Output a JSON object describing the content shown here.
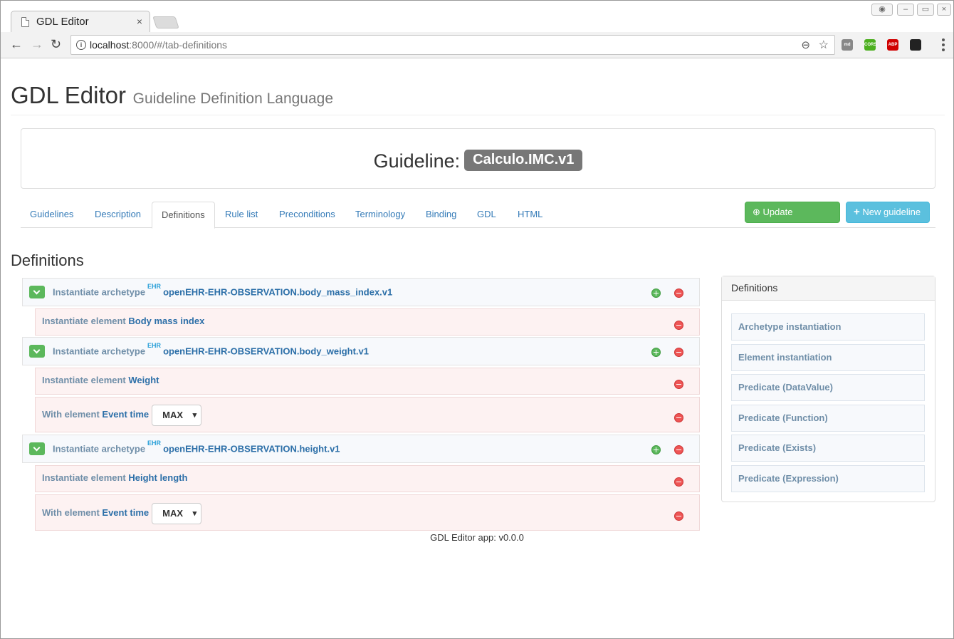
{
  "browser": {
    "tab_title": "GDL Editor",
    "tab_close": "×",
    "url_host": "localhost",
    "url_rest": ":8000/#/tab-definitions",
    "extensions": [
      {
        "name": "md-extension",
        "label": "md",
        "color": "#888888"
      },
      {
        "name": "cors-extension",
        "label": "CORS",
        "color": "#4caf1f"
      },
      {
        "name": "abp-extension",
        "label": "ABP",
        "color": "#d00000"
      },
      {
        "name": "gnome-extension",
        "label": "",
        "color": "#222222"
      }
    ]
  },
  "header": {
    "title": "GDL Editor",
    "subtitle": "Guideline Definition Language"
  },
  "guideline": {
    "prefix": "Guideline:",
    "id": "Calculo.IMC.v1"
  },
  "tabs": [
    {
      "label": "Guidelines",
      "active": false
    },
    {
      "label": "Description",
      "active": false
    },
    {
      "label": "Definitions",
      "active": true
    },
    {
      "label": "Rule list",
      "active": false
    },
    {
      "label": "Preconditions",
      "active": false
    },
    {
      "label": "Terminology",
      "active": false
    },
    {
      "label": "Binding",
      "active": false
    },
    {
      "label": "GDL",
      "active": false
    },
    {
      "label": "HTML",
      "active": false
    }
  ],
  "buttons": {
    "update": "Update guideline",
    "new": "New guideline"
  },
  "section_title": "Definitions",
  "definitions": [
    {
      "type": "archetype",
      "prefix": "Instantiate archetype",
      "tag": "EHR",
      "value": "openEHR-EHR-OBSERVATION.body_mass_index.v1"
    },
    {
      "type": "element",
      "prefix": "Instantiate element",
      "value": "Body mass index"
    },
    {
      "type": "archetype",
      "prefix": "Instantiate archetype",
      "tag": "EHR",
      "value": "openEHR-EHR-OBSERVATION.body_weight.v1"
    },
    {
      "type": "element",
      "prefix": "Instantiate element",
      "value": "Weight"
    },
    {
      "type": "with",
      "prefix": "With element",
      "value": "Event time",
      "select": "MAX"
    },
    {
      "type": "archetype",
      "prefix": "Instantiate archetype",
      "tag": "EHR",
      "value": "openEHR-EHR-OBSERVATION.height.v1"
    },
    {
      "type": "element",
      "prefix": "Instantiate element",
      "value": "Height length"
    },
    {
      "type": "with",
      "prefix": "With element",
      "value": "Event time",
      "select": "MAX"
    }
  ],
  "palette": {
    "title": "Definitions",
    "items": [
      "Archetype instantiation",
      "Element instantiation",
      "Predicate (DataValue)",
      "Predicate (Function)",
      "Predicate (Exists)",
      "Predicate (Expression)"
    ]
  },
  "footer": "GDL Editor app: v0.0.0"
}
